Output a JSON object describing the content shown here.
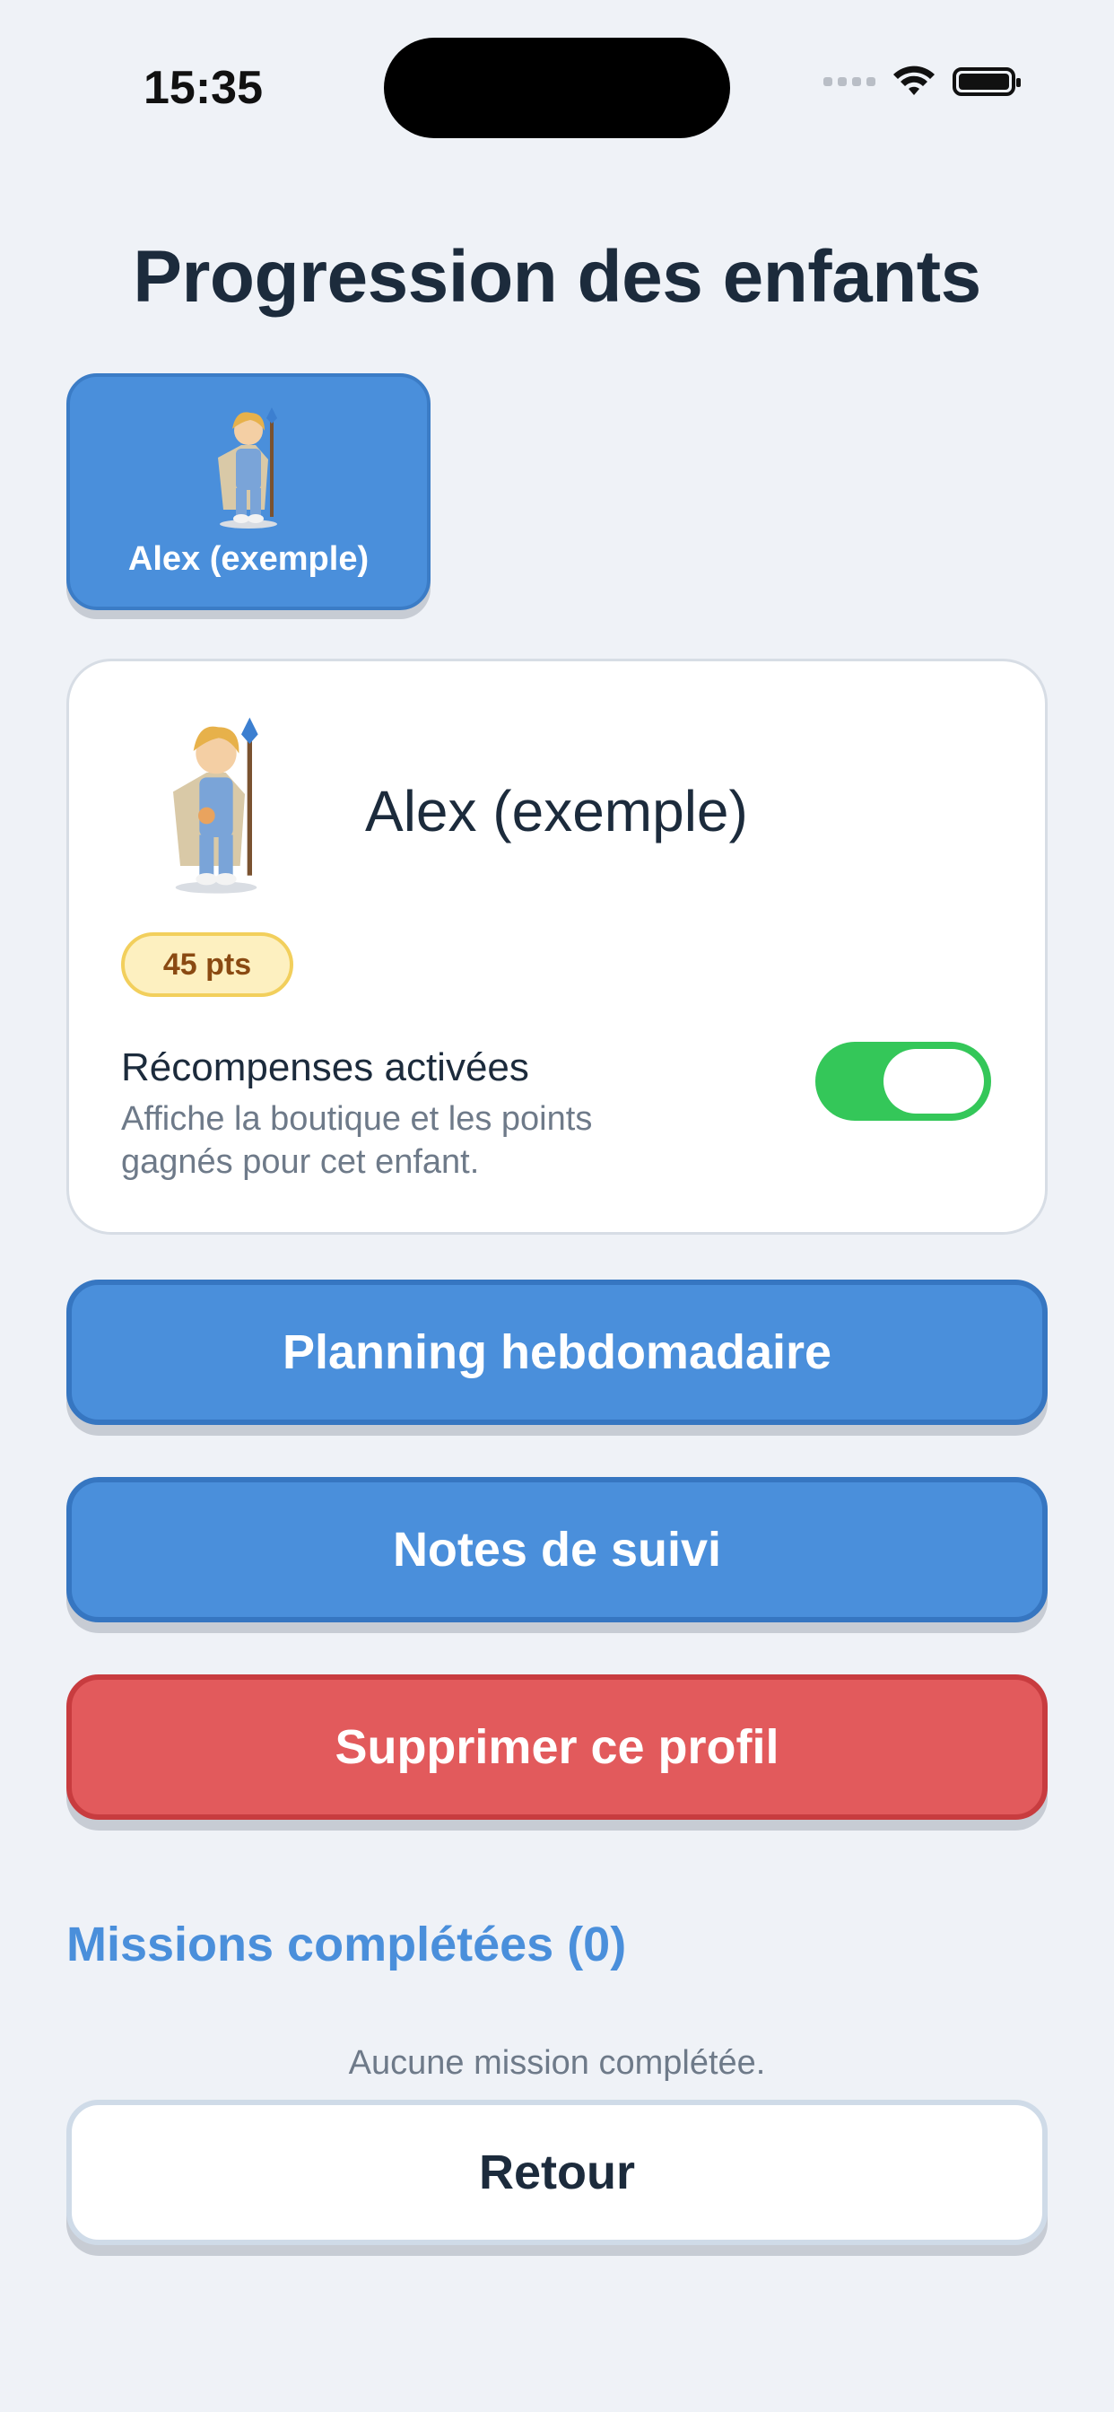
{
  "status_bar": {
    "time": "15:35",
    "icons": [
      "cellular-dots-icon",
      "wifi-icon",
      "battery-icon"
    ]
  },
  "page": {
    "title": "Progression des enfants"
  },
  "child_selector": {
    "items": [
      {
        "label": "Alex (exemple)",
        "avatar": "child-hero-avatar"
      }
    ]
  },
  "profile": {
    "name": "Alex (exemple)",
    "points": "45 pts",
    "rewards_title": "Récompenses activées",
    "rewards_desc": "Affiche la boutique et les points gagnés pour cet enfant.",
    "rewards_enabled": true
  },
  "actions": {
    "planning": "Planning hebdomadaire",
    "notes": "Notes de suivi",
    "delete": "Supprimer ce profil"
  },
  "missions": {
    "title": "Missions complétées (0)",
    "empty": "Aucune mission complétée."
  },
  "footer": {
    "back": "Retour"
  },
  "colors": {
    "primary": "#4a8fdb",
    "danger": "#e25a5c",
    "toggle_on": "#34c759",
    "badge_bg": "#fdf0c0"
  }
}
